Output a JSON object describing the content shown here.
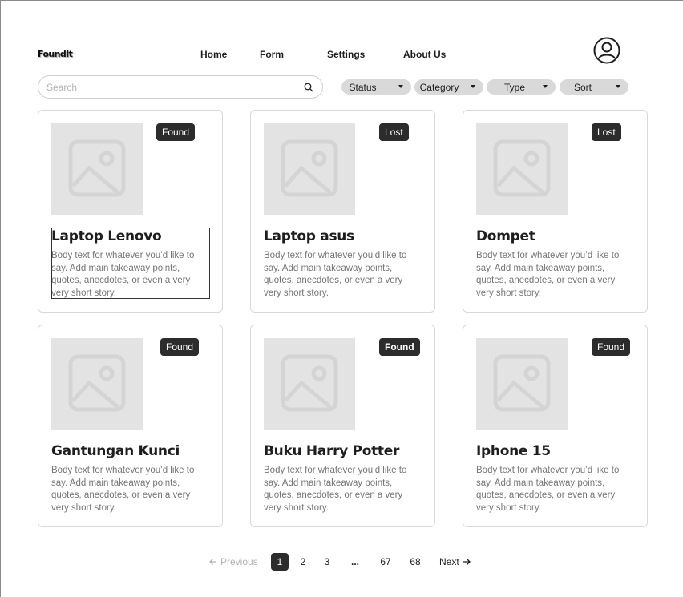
{
  "app": {
    "logo": "FoundIt"
  },
  "nav": [
    {
      "label": "Home"
    },
    {
      "label": "Form"
    },
    {
      "label": "Settings"
    },
    {
      "label": "About Us"
    }
  ],
  "search": {
    "placeholder": "Search",
    "value": ""
  },
  "filters": [
    {
      "label": "Status"
    },
    {
      "label": "Category"
    },
    {
      "label": "Type"
    },
    {
      "label": "Sort"
    }
  ],
  "cards": [
    {
      "title": "Laptop Lenovo",
      "badge": "Found",
      "body": "Body text for whatever you’d like to say. Add main takeaway points, quotes, anecdotes, or even a very very short story."
    },
    {
      "title": "Laptop asus",
      "badge": "Lost",
      "body": "Body text for whatever you’d like to say. Add main takeaway points, quotes, anecdotes, or even a very very short story."
    },
    {
      "title": "Dompet",
      "badge": "Lost",
      "body": "Body text for whatever you’d like to say. Add main takeaway points, quotes, anecdotes, or even a very very short story."
    },
    {
      "title": "Gantungan Kunci",
      "badge": "Found",
      "body": "Body text for whatever you’d like to say. Add main takeaway points, quotes, anecdotes, or even a very very short story."
    },
    {
      "title": "Buku Harry Potter",
      "badge": "Found",
      "body": "Body text for whatever you’d like to say. Add main takeaway points, quotes, anecdotes, or even a very very short story."
    },
    {
      "title": "Iphone 15",
      "badge": "Found",
      "body": "Body text for whatever you’d like to say. Add main takeaway points, quotes, anecdotes, or even a very very short story."
    }
  ],
  "pagination": {
    "previous": "Previous",
    "next": "Next",
    "pages": [
      "1",
      "2",
      "3",
      "...",
      "67",
      "68"
    ],
    "current": "1"
  },
  "colors": {
    "badge_bg": "#2c2c2c",
    "thumb_bg": "#e3e3e3",
    "filter_bg": "#d9d9d9"
  },
  "icons": {
    "profile": "user-circle-icon",
    "search": "search-icon",
    "caret": "caret-down-icon",
    "image": "image-placeholder-icon",
    "prev": "arrow-left-icon",
    "next": "arrow-right-icon"
  }
}
